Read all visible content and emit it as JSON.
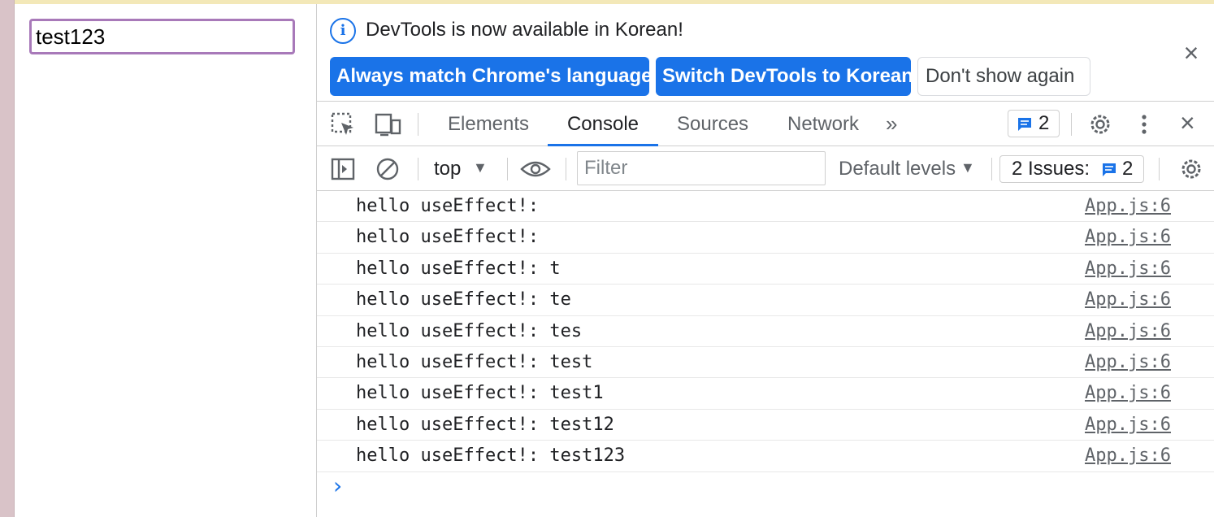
{
  "page": {
    "input_value": "test123"
  },
  "infobar": {
    "message": "DevTools is now available in Korean!",
    "buttons": {
      "always_match": "Always match Chrome's language",
      "switch": "Switch DevTools to Korean",
      "dont_show": "Don't show again"
    }
  },
  "tabs": [
    {
      "label": "Elements"
    },
    {
      "label": "Console"
    },
    {
      "label": "Sources"
    },
    {
      "label": "Network"
    }
  ],
  "tabbar": {
    "message_count": "2"
  },
  "toolbar": {
    "context": "top",
    "filter_placeholder": "Filter",
    "levels": "Default levels",
    "issues_label": "2 Issues:",
    "issues_count": "2"
  },
  "console": {
    "rows": [
      {
        "msg": "hello useEffect!: ",
        "src": "App.js:6"
      },
      {
        "msg": "hello useEffect!: ",
        "src": "App.js:6"
      },
      {
        "msg": "hello useEffect!: t",
        "src": "App.js:6"
      },
      {
        "msg": "hello useEffect!: te",
        "src": "App.js:6"
      },
      {
        "msg": "hello useEffect!: tes",
        "src": "App.js:6"
      },
      {
        "msg": "hello useEffect!: test",
        "src": "App.js:6"
      },
      {
        "msg": "hello useEffect!: test1",
        "src": "App.js:6"
      },
      {
        "msg": "hello useEffect!: test12",
        "src": "App.js:6"
      },
      {
        "msg": "hello useEffect!: test123",
        "src": "App.js:6"
      }
    ],
    "prompt_icon": "chevron-right-icon"
  },
  "colors": {
    "accent": "#1a73e8",
    "input_border": "#a879b9"
  }
}
